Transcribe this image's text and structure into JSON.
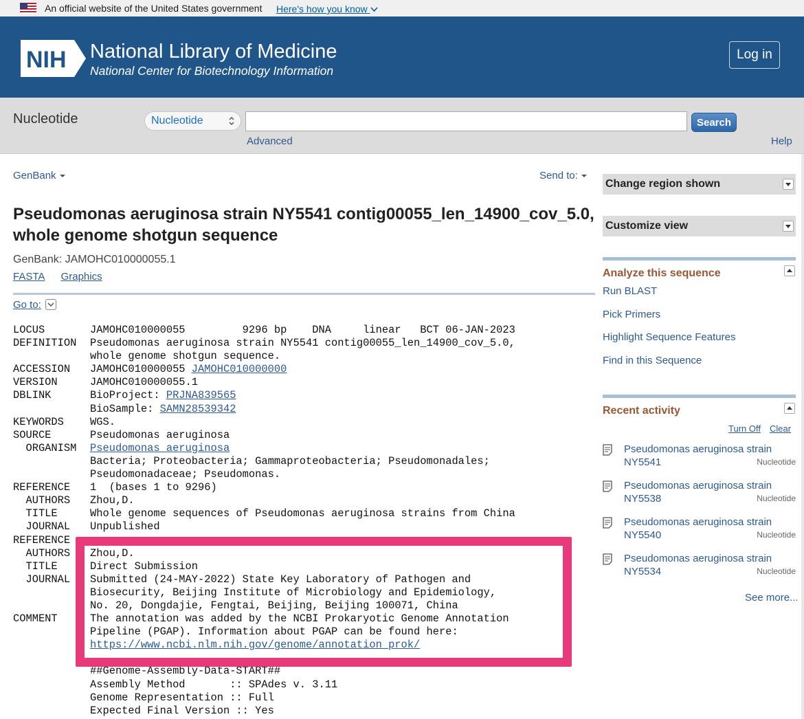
{
  "gov_banner": {
    "text": "An official website of the United States government",
    "link": "Here's how you know"
  },
  "header": {
    "logo": "NIH",
    "title": "National Library of Medicine",
    "subtitle": "National Center for Biotechnology Information",
    "login": "Log in"
  },
  "search": {
    "db_label": "Nucleotide",
    "db_selected": "Nucleotide",
    "query": "",
    "button": "Search",
    "advanced": "Advanced",
    "help": "Help"
  },
  "record": {
    "format_menu": "GenBank",
    "send_to": "Send to:",
    "title": "Pseudomonas aeruginosa strain NY5541 contig00055_len_14900_cov_5.0, whole genome shotgun sequence",
    "accession_line": "GenBank: JAMOHC010000055.1",
    "links": [
      "FASTA",
      "Graphics"
    ],
    "goto": "Go to:"
  },
  "flatfile": [
    {
      "key": "LOCUS",
      "val": "JAMOHC010000055         9296 bp    DNA     linear   BCT 06-JAN-2023"
    },
    {
      "key": "DEFINITION",
      "val": "Pseudomonas aeruginosa strain NY5541 contig00055_len_14900_cov_5.0,"
    },
    {
      "key": "",
      "val": "whole genome shotgun sequence."
    },
    {
      "key": "ACCESSION",
      "val": "JAMOHC010000055 ",
      "link": "JAMOHC010000000"
    },
    {
      "key": "VERSION",
      "val": "JAMOHC010000055.1"
    },
    {
      "key": "DBLINK",
      "val": "BioProject: ",
      "link": "PRJNA839565"
    },
    {
      "key": "",
      "val": "BioSample: ",
      "link": "SAMN28539342"
    },
    {
      "key": "KEYWORDS",
      "val": "WGS."
    },
    {
      "key": "SOURCE",
      "val": "Pseudomonas aeruginosa"
    },
    {
      "key": "  ORGANISM",
      "val": "",
      "link": "Pseudomonas aeruginosa"
    },
    {
      "key": "",
      "val": "Bacteria; Proteobacteria; Gammaproteobacteria; Pseudomonadales;"
    },
    {
      "key": "",
      "val": "Pseudomonadaceae; Pseudomonas."
    },
    {
      "key": "REFERENCE",
      "val": "1  (bases 1 to 9296)"
    },
    {
      "key": "  AUTHORS",
      "val": "Zhou,D."
    },
    {
      "key": "  TITLE",
      "val": "Whole genome sequences of Pseudomonas aeruginosa strains from China"
    },
    {
      "key": "  JOURNAL",
      "val": "Unpublished"
    },
    {
      "key": "REFERENCE",
      "val": ""
    },
    {
      "key": "  AUTHORS",
      "val": "Zhou,D."
    },
    {
      "key": "  TITLE",
      "val": "Direct Submission"
    },
    {
      "key": "  JOURNAL",
      "val": "Submitted (24-MAY-2022) State Key Laboratory of Pathogen and"
    },
    {
      "key": "",
      "val": "Biosecurity, Beijing Institute of Microbiology and Epidemiology,"
    },
    {
      "key": "",
      "val": "No. 20, Dongdajie, Fengtai, Beijing, Beijing 100071, China"
    },
    {
      "key": "COMMENT",
      "val": "The annotation was added by the NCBI Prokaryotic Genome Annotation"
    },
    {
      "key": "",
      "val": "Pipeline (PGAP). Information about PGAP can be found here:"
    },
    {
      "key": "",
      "val": "",
      "link": "https://www.ncbi.nlm.nih.gov/genome/annotation_prok/"
    },
    {
      "key": "",
      "val": ""
    },
    {
      "key": "",
      "val": "##Genome-Assembly-Data-START##"
    },
    {
      "key": "",
      "val": "Assembly Method       :: SPAdes v. 3.11"
    },
    {
      "key": "",
      "val": "Genome Representation :: Full"
    },
    {
      "key": "",
      "val": "Expected Final Version :: Yes"
    }
  ],
  "sidebar": {
    "change_region": "Change region shown",
    "customize_view": "Customize view",
    "analyze_title": "Analyze this sequence",
    "analyze_links": [
      "Run BLAST",
      "Pick Primers",
      "Highlight Sequence Features",
      "Find in this Sequence"
    ],
    "recent_title": "Recent activity",
    "turn_off": "Turn Off",
    "clear": "Clear",
    "recent_items": [
      {
        "title": "Pseudomonas aeruginosa strain NY5541",
        "db": "Nucleotide"
      },
      {
        "title": "Pseudomonas aeruginosa strain NY5538",
        "db": "Nucleotide"
      },
      {
        "title": "Pseudomonas aeruginosa strain NY5540",
        "db": "Nucleotide"
      },
      {
        "title": "Pseudomonas aeruginosa strain NY5534",
        "db": "Nucleotide"
      }
    ],
    "see_more": "See more..."
  },
  "colors": {
    "header_bg": "#20558a",
    "link": "#2c5a91",
    "section_title": "#985735",
    "highlight_border": "#e83a7a"
  }
}
